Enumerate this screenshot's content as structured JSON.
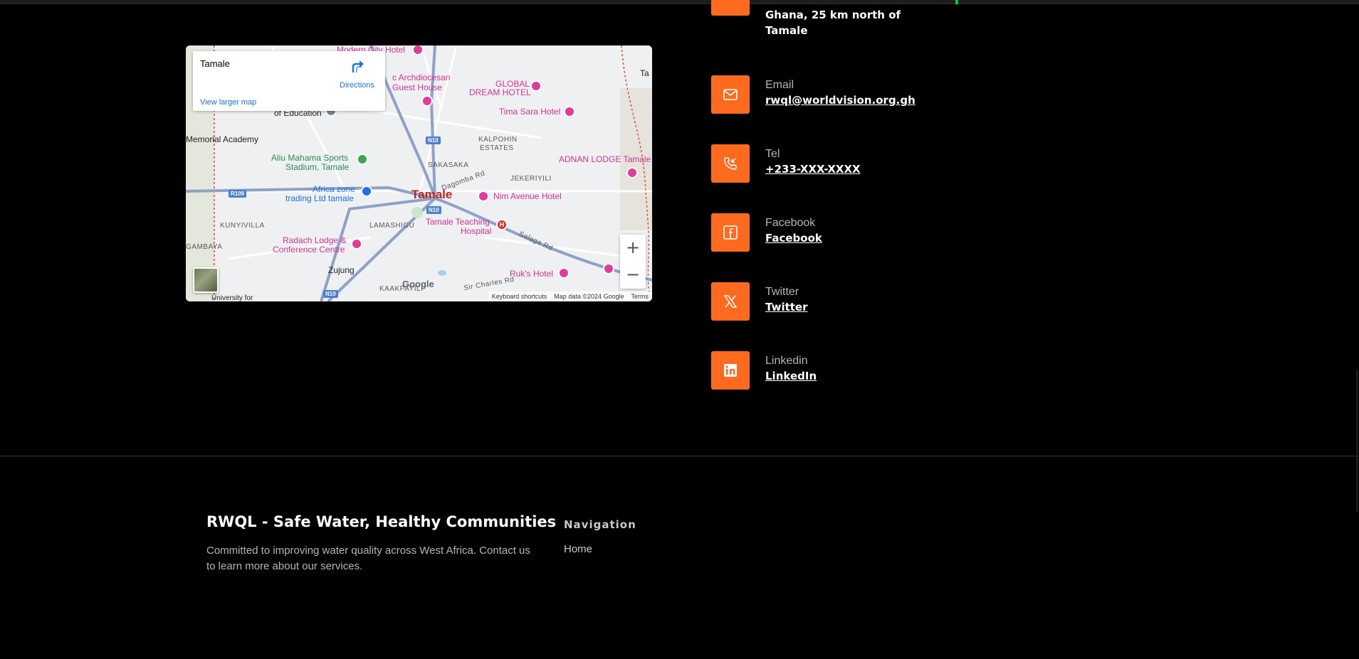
{
  "map": {
    "place_name": "Tamale",
    "directions_label": "Directions",
    "view_larger_label": "View larger map",
    "attribution": {
      "keyboard": "Keyboard shortcuts",
      "map_data": "Map data ©2024 Google",
      "terms": "Terms"
    },
    "google_logo": "Google",
    "zoom_in": "+",
    "zoom_out": "−",
    "labels": {
      "modern_city_hotel": "Modern City Hotel",
      "archdiocesan": "c Archdiocesan",
      "guest_house": "Guest House",
      "global_dream": "GLOBAL",
      "global_dream2": "DREAM HOTEL",
      "tima_sara": "Tima Sara Hotel",
      "of_education": "of Education",
      "memorial_academy": "Memorial Academy",
      "kalpohin": "KALPOHIN",
      "estates": "ESTATES",
      "aliu_mahama": "Aliu Mahama Sports",
      "stadium": "Stadium, Tamale",
      "sakasaka": "SAKASAKA",
      "adnan_lodge": "ADNAN LODGE Tamale",
      "dagomba_rd": "Dagomba Rd",
      "jekeriyili": "JEKERIYILI",
      "africa_zone": "Africa zone",
      "trading": "trading Ltd tamale",
      "tamale_city": "Tamale",
      "nim_avenue": "Nim Avenue Hotel",
      "kunyivilla": "KUNYIVILLA",
      "lamashigu": "LAMASHIGU",
      "teaching_hospital": "Tamale Teaching",
      "hospital": "Hospital",
      "gambaya": "GAMBAYA",
      "radach": "Radach Lodge &",
      "conference": "Conference Centre",
      "salaga_rd": "Salaga Rd",
      "zujung": "Zujung",
      "ruks_hotel": "Ruk's Hotel",
      "kaakpayili": "KAAKPAYILI",
      "sir_charles": "Sir Charles Rd",
      "university": "University for",
      "ta": "Ta",
      "r109": "R109",
      "n10a": "N10",
      "n10b": "N10",
      "n10c": "N10"
    }
  },
  "contact": {
    "address_lines": "Ghana, 25 km north of Tamale",
    "items": [
      {
        "label": "Email",
        "value": "rwql@worldvision.org.gh",
        "icon": "envelope-icon"
      },
      {
        "label": "Tel",
        "value": "+233-XXX-XXXX",
        "icon": "phone-icon"
      },
      {
        "label": "Facebook",
        "value": "Facebook",
        "icon": "facebook-icon"
      },
      {
        "label": "Twitter",
        "value": "Twitter",
        "icon": "x-twitter-icon"
      },
      {
        "label": "Linkedin",
        "value": "LinkedIn",
        "icon": "linkedin-icon"
      }
    ]
  },
  "footer": {
    "title": "RWQL - Safe Water, Healthy Communities",
    "description": "Committed to improving water quality across West Africa. Contact us to learn more about our services.",
    "nav_title": "Navigation",
    "nav_items": [
      "Home"
    ]
  },
  "colors": {
    "accent": "#ff6a1f",
    "background": "#000000",
    "muted_text": "#b5b5b5"
  }
}
